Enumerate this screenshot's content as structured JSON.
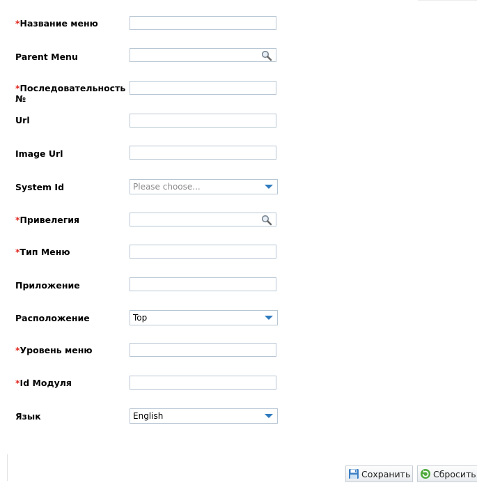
{
  "form": {
    "fields": [
      {
        "label": "Название меню",
        "required": true,
        "type": "text",
        "value": ""
      },
      {
        "label": "Parent Menu",
        "required": false,
        "type": "lookup",
        "value": ""
      },
      {
        "label": "Последовательность",
        "label_line2": "№",
        "required": true,
        "type": "text",
        "value": ""
      },
      {
        "label": "Url",
        "required": false,
        "type": "text",
        "value": ""
      },
      {
        "label": "Image Url",
        "required": false,
        "type": "text",
        "value": ""
      },
      {
        "label": "System Id",
        "required": false,
        "type": "select",
        "value": "Please choose..."
      },
      {
        "label": "Привелегия",
        "required": true,
        "type": "lookup",
        "value": ""
      },
      {
        "label": "Тип Меню",
        "required": true,
        "type": "text",
        "value": ""
      },
      {
        "label": "Приложение",
        "required": false,
        "type": "text",
        "value": ""
      },
      {
        "label": "Расположение",
        "required": false,
        "type": "select",
        "value": "Top"
      },
      {
        "label": "Уровень меню",
        "required": true,
        "type": "text",
        "value": ""
      },
      {
        "label": "Id Модуля",
        "required": true,
        "type": "text",
        "value": ""
      },
      {
        "label": "Язык",
        "required": false,
        "type": "select",
        "value": "English"
      }
    ],
    "required_marker": "*"
  },
  "buttons": {
    "save_label": "Сохранить",
    "reset_label": "Сбросить"
  },
  "colors": {
    "required": "#e0281f",
    "field_border": "#b7c6d3",
    "caret": "#2f7bbf"
  },
  "icons": {
    "lookup": "magnifier-icon",
    "save": "floppy-disk-icon",
    "reset": "refresh-icon"
  }
}
